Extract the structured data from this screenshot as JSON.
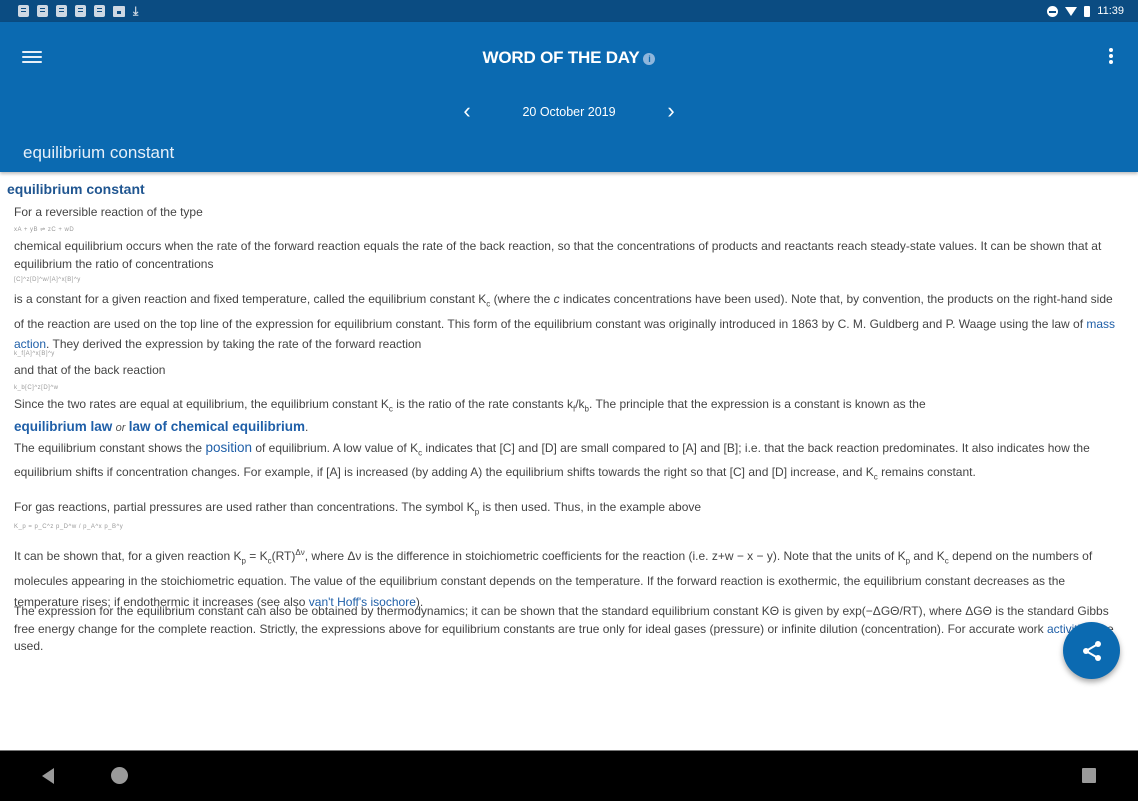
{
  "status_bar": {
    "notification_icons": [
      "note-icon",
      "note-icon",
      "note-icon",
      "note-icon",
      "note-icon",
      "image-icon",
      "download-icon"
    ],
    "system_icons": [
      "do-not-disturb-icon",
      "wifi-icon",
      "battery-icon"
    ],
    "time": "11:39"
  },
  "app_bar": {
    "menu_icon": "hamburger-menu-icon",
    "title": "WORD OF THE DAY",
    "info_icon_glyph": "i",
    "more_icon": "more-vert-icon",
    "prev_glyph": "‹",
    "next_glyph": "›",
    "date": "20 October 2019",
    "word": "equilibrium constant"
  },
  "entry": {
    "headword": "equilibrium constant",
    "p1": "For a reversible reaction of the type",
    "eq1": "xA + yB ⇌ zC + wD",
    "p2": " chemical equilibrium occurs when the rate of the forward reaction equals the rate of the back reaction, so that the concentrations of products and reactants reach steady-state values. It can be shown that at equilibrium the ratio of concentrations",
    "eq2": "[C]^z[D]^w/[A]^x[B]^y",
    "p3_a": " is a constant for a given reaction and fixed temperature, called the equilibrium constant K",
    "p3_sub": "c",
    "p3_b": " (where the ",
    "p3_c_italic": "c",
    "p3_c": " indicates concentrations have been used). Note that, by convention, the products on the right-hand side of the reaction are used on the top line of the expression for equilibrium constant. This form of the equilibrium constant was originally introduced in 1863 by C. M. Guldberg and P. Waage using the law of ",
    "p3_link": "mass action",
    "p3_d": ". They derived the expression by taking the rate of the forward reaction",
    "eq3": "k_f[A]^x[B]^y",
    "p4": " and that of the back reaction",
    "eq4": "k_b[C]^z[D]^w",
    "p5_a": " Since the two rates are equal at equilibrium, the equilibrium constant K",
    "p5_sub": "c",
    "p5_b": " is the ratio of the rate constants k",
    "p5_sub2": "f",
    "p5_c": "/k",
    "p5_sub3": "b",
    "p5_d": ". The principle that the expression is a constant is known as the",
    "law_link1": "equilibrium law",
    "law_or": "or",
    "law_link2": "law of chemical equilibrium",
    "law_dot": ".",
    "p6_a": "The equilibrium constant shows the ",
    "p6_link": "position",
    "p6_b": " of equilibrium. A low value of K",
    "p6_sub": "c",
    "p6_c": " indicates that [C] and [D] are small compared to [A] and [B]; i.e. that the back reaction predominates. It also indicates how the equilibrium shifts if concentration changes. For example, if [A] is increased (by adding A) the equilibrium shifts towards the right so that [C] and [D] increase, and K",
    "p6_sub2": "c",
    "p6_d": " remains constant.",
    "p7_a": "For gas reactions, partial pressures are used rather than concentrations. The symbol K",
    "p7_sub": "p",
    "p7_b": " is then used. Thus, in the example above",
    "eq5": "K_p = p_C^z p_D^w / p_A^x p_B^y",
    "p8_a": " It can be shown that, for a given reaction K",
    "p8_sub": "p",
    "p8_b": " = K",
    "p8_sub2": "c",
    "p8_c": "(RT)",
    "p8_sup": "Δν",
    "p8_d": ", where Δν is the difference in stoichiometric coefficients for the reaction (i.e. z+w − x − y). Note that the units of K",
    "p8_sub3": "p",
    "p8_e": " and K",
    "p8_sub4": "c",
    "p8_f": " depend on the numbers of molecules appearing in the stoichiometric equation. The value of the equilibrium constant depends on the temperature. If the forward reaction is exothermic, the equilibrium constant decreases as the temperature rises; if endothermic it increases (see also ",
    "p8_link": "van't Hoff's isochore",
    "p8_g": ").",
    "p9_a": "The expression for the equilibrium constant can also be obtained by thermodynamics; it can be shown that the standard equilibrium constant KΘ is given by exp(−ΔGΘ/RT), where ΔGΘ is the standard Gibbs free energy change for the complete reaction. Strictly, the expressions above for equilibrium constants are true only for ideal gases (pressure) or infinite dilution (concentration). For accurate work ",
    "p9_link": "activities",
    "p9_b": " are used."
  },
  "fab": {
    "icon": "share-icon"
  },
  "nav_bar": {
    "icons": [
      "back-icon",
      "home-icon",
      "recents-icon"
    ]
  },
  "colors": {
    "app_bar": "#0b6ab1",
    "status_bar": "#0b4c82",
    "link": "#1f5fa8",
    "headword": "#1f5590"
  }
}
